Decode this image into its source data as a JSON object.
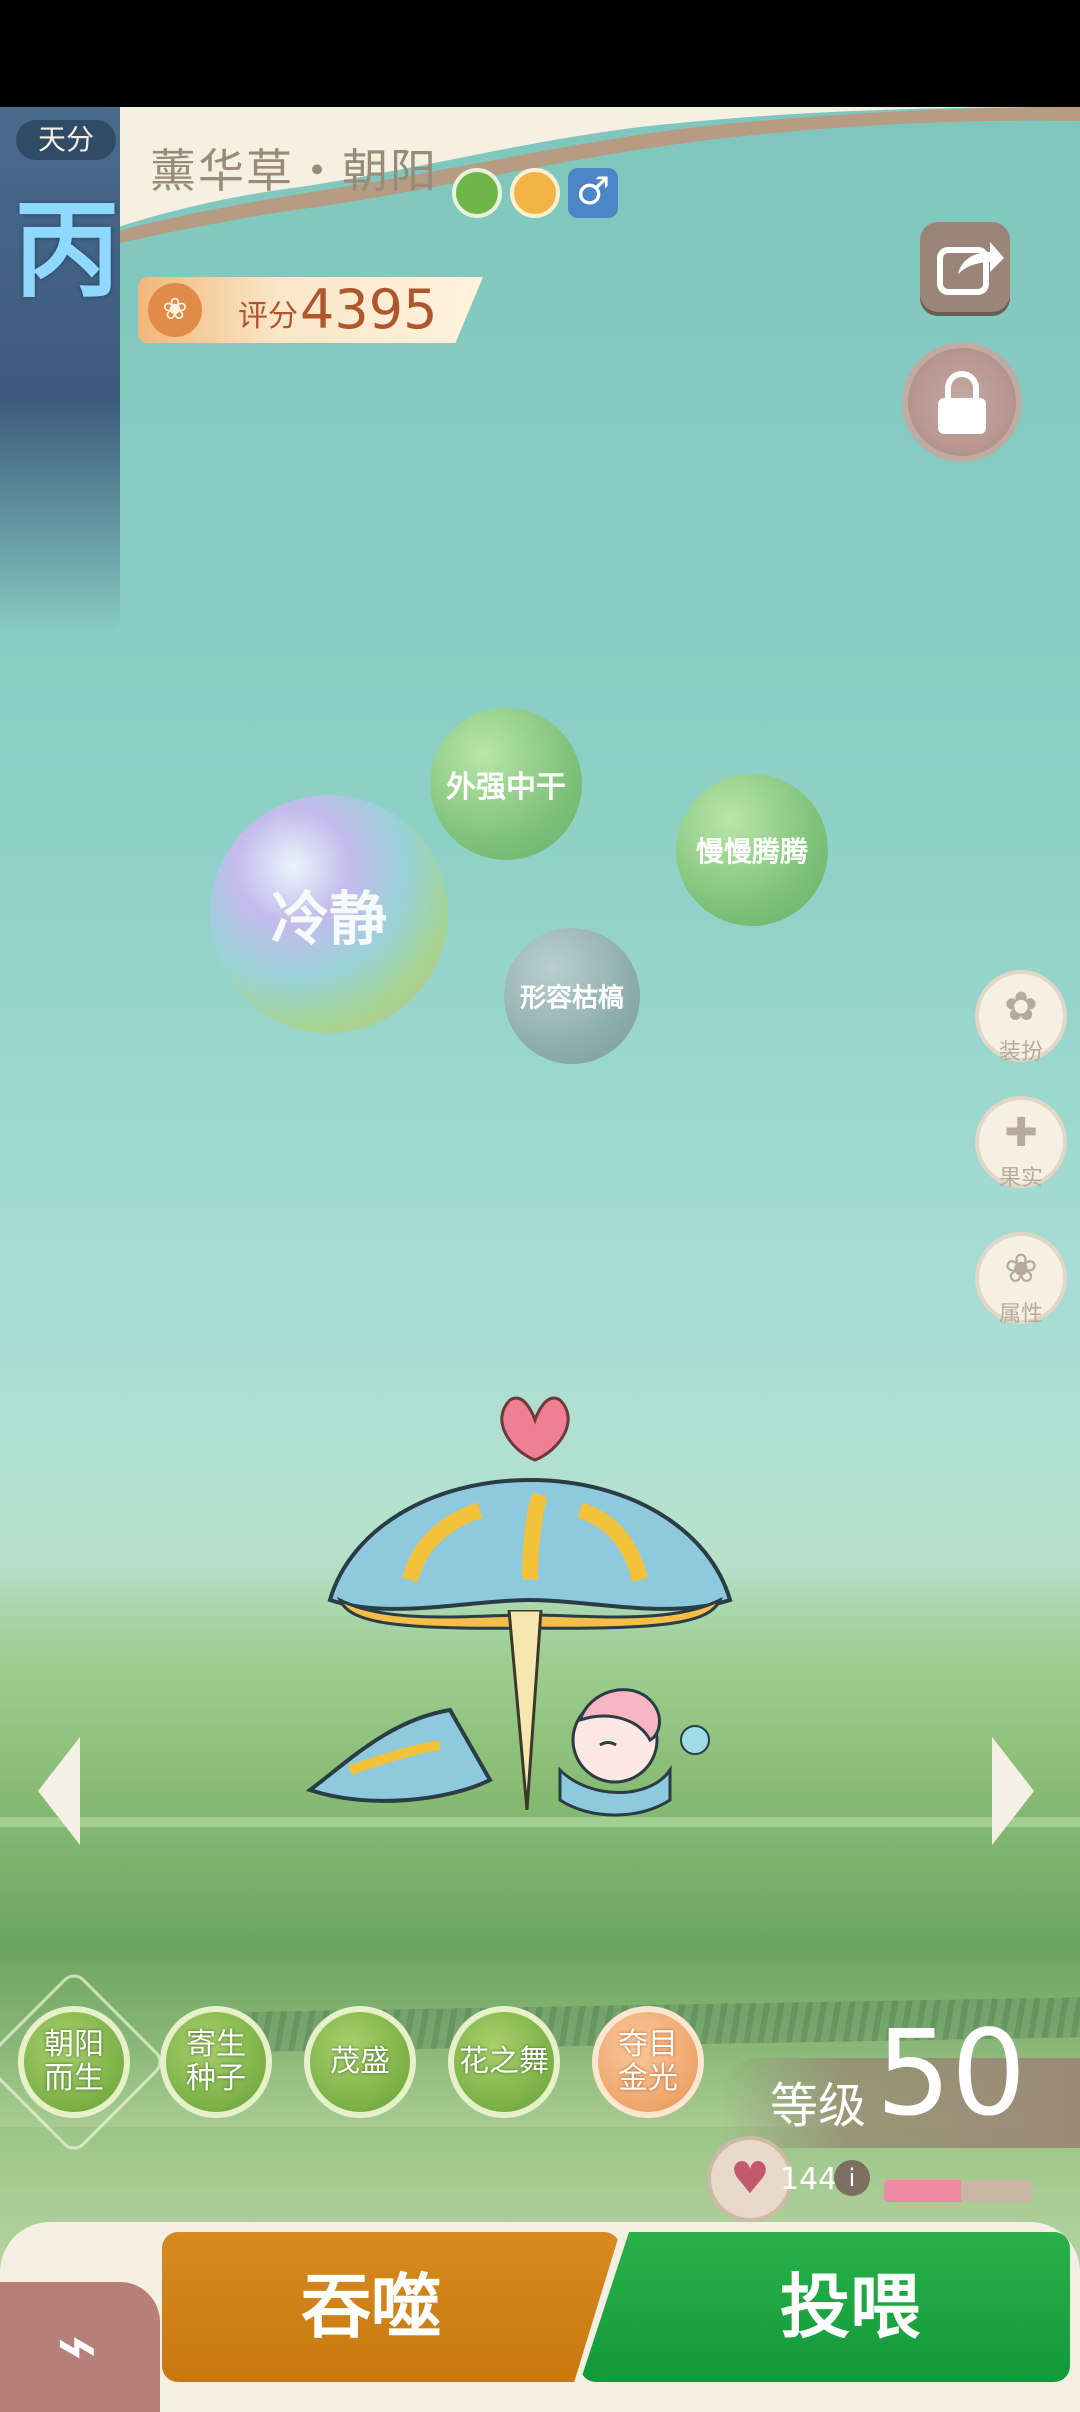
{
  "header": {
    "rank_label": "天分",
    "rank_value": "丙",
    "pet_name": "薰华草・朝阳",
    "type_icons": [
      "grass-element-icon",
      "sun-element-icon",
      "male-icon"
    ],
    "gender_symbol": "♂",
    "score_label": "评分",
    "score_value": "4395"
  },
  "top_buttons": {
    "share_icon": "share-icon",
    "lock_icon": "lock-icon"
  },
  "traits": {
    "main": "冷静",
    "items": [
      "外强中干",
      "慢慢腾腾",
      "形容枯槁"
    ]
  },
  "side_menu": [
    {
      "label": "装扮",
      "icon": "butterfly-icon",
      "glyph": "✿"
    },
    {
      "label": "果实",
      "icon": "plus-icon",
      "glyph": "✚"
    },
    {
      "label": "属性",
      "icon": "paw-icon",
      "glyph": "❀"
    }
  ],
  "skills": [
    {
      "label": "朝阳\n而生",
      "color": "green"
    },
    {
      "label": "寄生\n种子",
      "color": "green"
    },
    {
      "label": "茂盛",
      "color": "green"
    },
    {
      "label": "花之舞",
      "color": "green"
    },
    {
      "label": "夺目\n金光",
      "color": "orange"
    }
  ],
  "level": {
    "label": "等级",
    "value": "50"
  },
  "hp": {
    "value": "144",
    "fill_fraction": 0.52,
    "bar_color": "#f08aa0"
  },
  "actions": {
    "devour_label": "吞噬",
    "feed_label": "投喂"
  },
  "colors": {
    "devour": "#d08419",
    "feed": "#1da743",
    "rank_panel": "#3c5a7c"
  }
}
